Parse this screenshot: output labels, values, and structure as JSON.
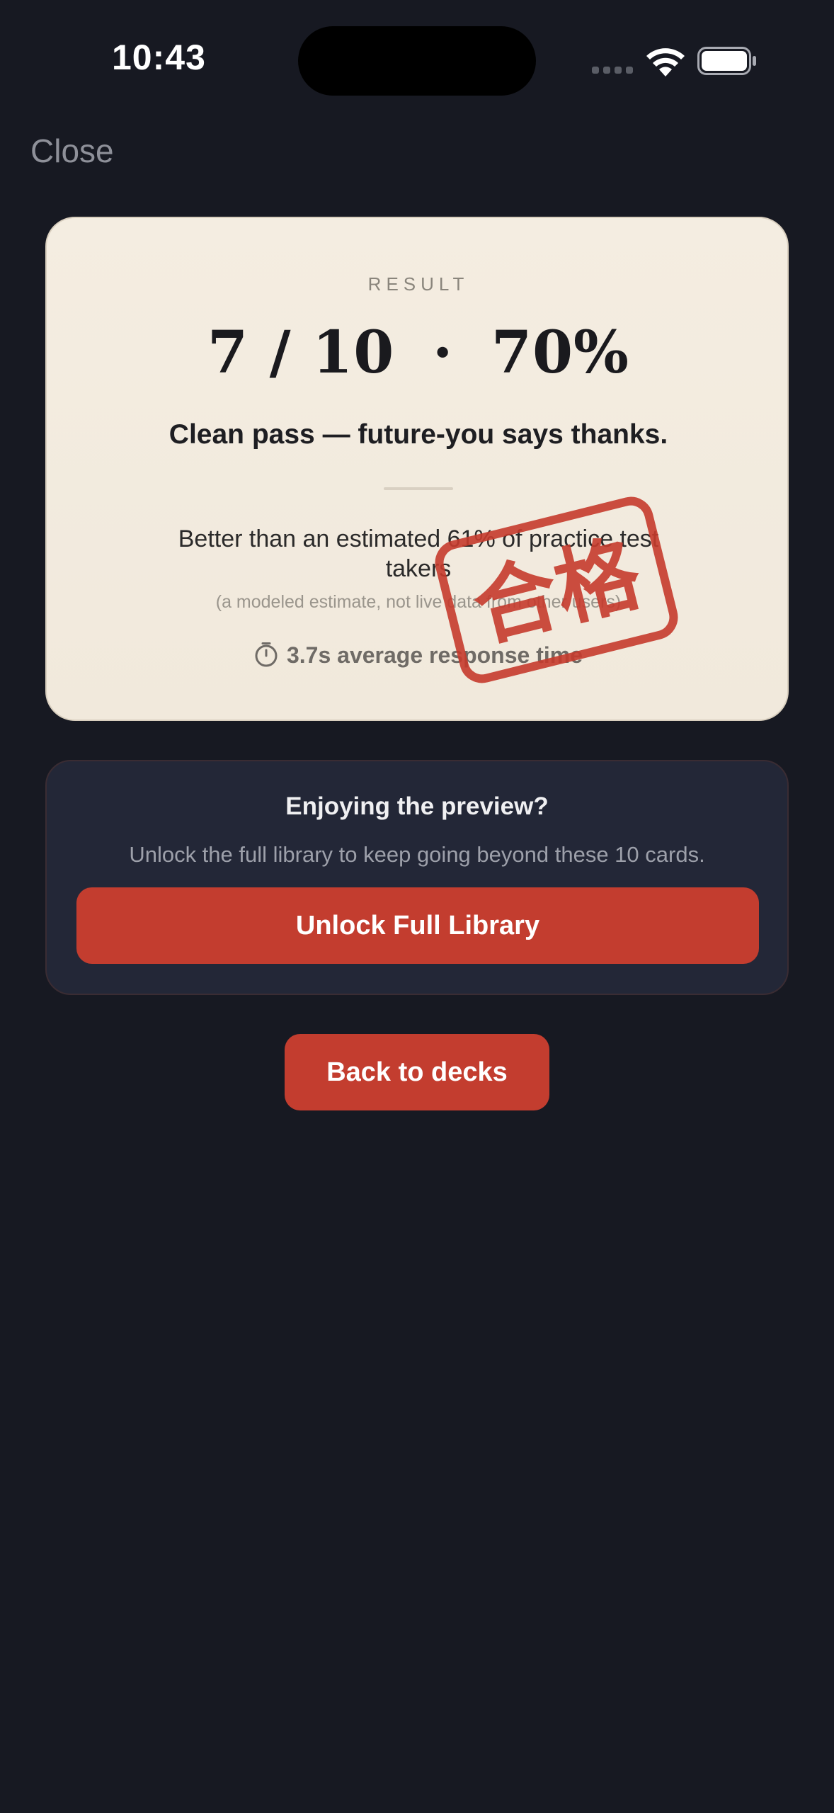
{
  "status_bar": {
    "time": "10:43"
  },
  "nav": {
    "close_label": "Close"
  },
  "result_card": {
    "label": "RESULT",
    "score": "7 / 10",
    "separator": "·",
    "percent": "70%",
    "verdict": "Clean pass — future-you says thanks.",
    "percentile_text": "Better than an estimated 61% of practice test takers",
    "percentile_note": "(a modeled estimate, not live data from other users)",
    "response_time": "3.7s average response time",
    "stamp_text": "合格",
    "stamp_color": "#c63b2d"
  },
  "preview": {
    "title": "Enjoying the preview?",
    "subtitle": "Unlock the full library to keep going beyond these 10 cards.",
    "unlock_label": "Unlock Full Library"
  },
  "actions": {
    "back_label": "Back to decks"
  },
  "colors": {
    "background": "#171922",
    "accent": "#c33d2f",
    "card": "#f4ede1",
    "panel": "#232737"
  }
}
